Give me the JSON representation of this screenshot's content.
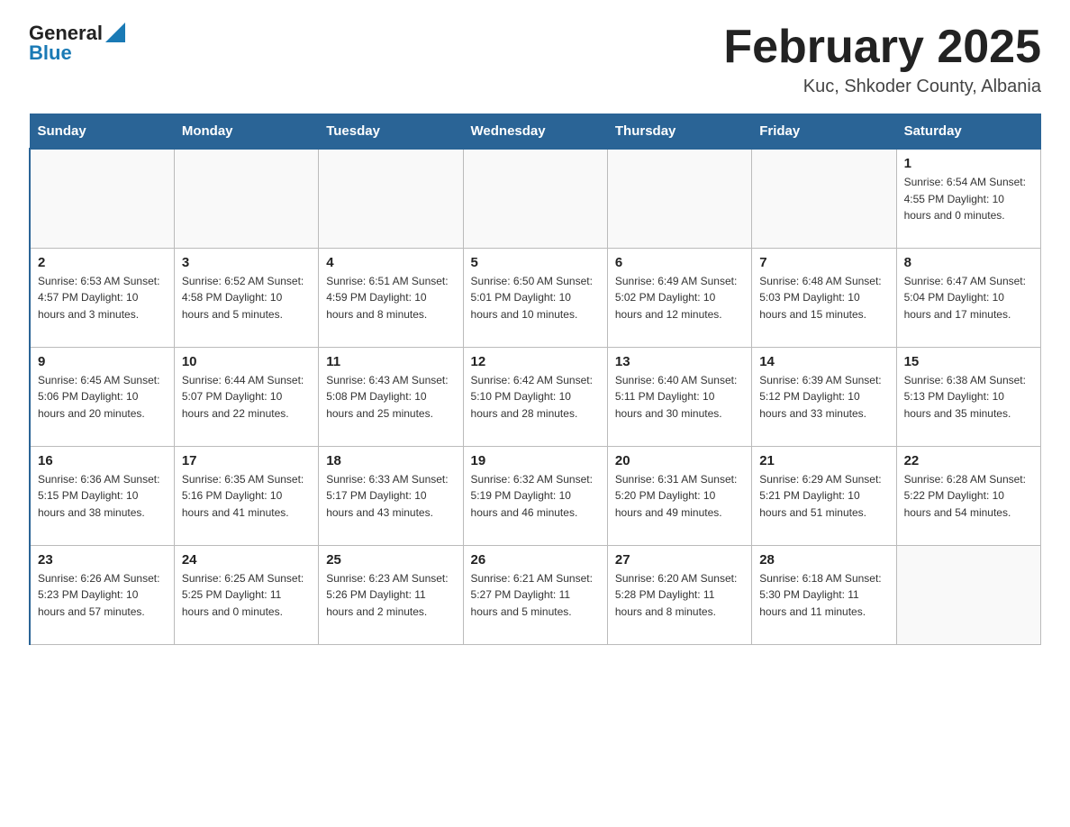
{
  "logo": {
    "text_general": "General",
    "text_blue": "Blue"
  },
  "title": "February 2025",
  "location": "Kuc, Shkoder County, Albania",
  "days_of_week": [
    "Sunday",
    "Monday",
    "Tuesday",
    "Wednesday",
    "Thursday",
    "Friday",
    "Saturday"
  ],
  "weeks": [
    [
      {
        "day": "",
        "info": ""
      },
      {
        "day": "",
        "info": ""
      },
      {
        "day": "",
        "info": ""
      },
      {
        "day": "",
        "info": ""
      },
      {
        "day": "",
        "info": ""
      },
      {
        "day": "",
        "info": ""
      },
      {
        "day": "1",
        "info": "Sunrise: 6:54 AM\nSunset: 4:55 PM\nDaylight: 10 hours and 0 minutes."
      }
    ],
    [
      {
        "day": "2",
        "info": "Sunrise: 6:53 AM\nSunset: 4:57 PM\nDaylight: 10 hours and 3 minutes."
      },
      {
        "day": "3",
        "info": "Sunrise: 6:52 AM\nSunset: 4:58 PM\nDaylight: 10 hours and 5 minutes."
      },
      {
        "day": "4",
        "info": "Sunrise: 6:51 AM\nSunset: 4:59 PM\nDaylight: 10 hours and 8 minutes."
      },
      {
        "day": "5",
        "info": "Sunrise: 6:50 AM\nSunset: 5:01 PM\nDaylight: 10 hours and 10 minutes."
      },
      {
        "day": "6",
        "info": "Sunrise: 6:49 AM\nSunset: 5:02 PM\nDaylight: 10 hours and 12 minutes."
      },
      {
        "day": "7",
        "info": "Sunrise: 6:48 AM\nSunset: 5:03 PM\nDaylight: 10 hours and 15 minutes."
      },
      {
        "day": "8",
        "info": "Sunrise: 6:47 AM\nSunset: 5:04 PM\nDaylight: 10 hours and 17 minutes."
      }
    ],
    [
      {
        "day": "9",
        "info": "Sunrise: 6:45 AM\nSunset: 5:06 PM\nDaylight: 10 hours and 20 minutes."
      },
      {
        "day": "10",
        "info": "Sunrise: 6:44 AM\nSunset: 5:07 PM\nDaylight: 10 hours and 22 minutes."
      },
      {
        "day": "11",
        "info": "Sunrise: 6:43 AM\nSunset: 5:08 PM\nDaylight: 10 hours and 25 minutes."
      },
      {
        "day": "12",
        "info": "Sunrise: 6:42 AM\nSunset: 5:10 PM\nDaylight: 10 hours and 28 minutes."
      },
      {
        "day": "13",
        "info": "Sunrise: 6:40 AM\nSunset: 5:11 PM\nDaylight: 10 hours and 30 minutes."
      },
      {
        "day": "14",
        "info": "Sunrise: 6:39 AM\nSunset: 5:12 PM\nDaylight: 10 hours and 33 minutes."
      },
      {
        "day": "15",
        "info": "Sunrise: 6:38 AM\nSunset: 5:13 PM\nDaylight: 10 hours and 35 minutes."
      }
    ],
    [
      {
        "day": "16",
        "info": "Sunrise: 6:36 AM\nSunset: 5:15 PM\nDaylight: 10 hours and 38 minutes."
      },
      {
        "day": "17",
        "info": "Sunrise: 6:35 AM\nSunset: 5:16 PM\nDaylight: 10 hours and 41 minutes."
      },
      {
        "day": "18",
        "info": "Sunrise: 6:33 AM\nSunset: 5:17 PM\nDaylight: 10 hours and 43 minutes."
      },
      {
        "day": "19",
        "info": "Sunrise: 6:32 AM\nSunset: 5:19 PM\nDaylight: 10 hours and 46 minutes."
      },
      {
        "day": "20",
        "info": "Sunrise: 6:31 AM\nSunset: 5:20 PM\nDaylight: 10 hours and 49 minutes."
      },
      {
        "day": "21",
        "info": "Sunrise: 6:29 AM\nSunset: 5:21 PM\nDaylight: 10 hours and 51 minutes."
      },
      {
        "day": "22",
        "info": "Sunrise: 6:28 AM\nSunset: 5:22 PM\nDaylight: 10 hours and 54 minutes."
      }
    ],
    [
      {
        "day": "23",
        "info": "Sunrise: 6:26 AM\nSunset: 5:23 PM\nDaylight: 10 hours and 57 minutes."
      },
      {
        "day": "24",
        "info": "Sunrise: 6:25 AM\nSunset: 5:25 PM\nDaylight: 11 hours and 0 minutes."
      },
      {
        "day": "25",
        "info": "Sunrise: 6:23 AM\nSunset: 5:26 PM\nDaylight: 11 hours and 2 minutes."
      },
      {
        "day": "26",
        "info": "Sunrise: 6:21 AM\nSunset: 5:27 PM\nDaylight: 11 hours and 5 minutes."
      },
      {
        "day": "27",
        "info": "Sunrise: 6:20 AM\nSunset: 5:28 PM\nDaylight: 11 hours and 8 minutes."
      },
      {
        "day": "28",
        "info": "Sunrise: 6:18 AM\nSunset: 5:30 PM\nDaylight: 11 hours and 11 minutes."
      },
      {
        "day": "",
        "info": ""
      }
    ]
  ]
}
